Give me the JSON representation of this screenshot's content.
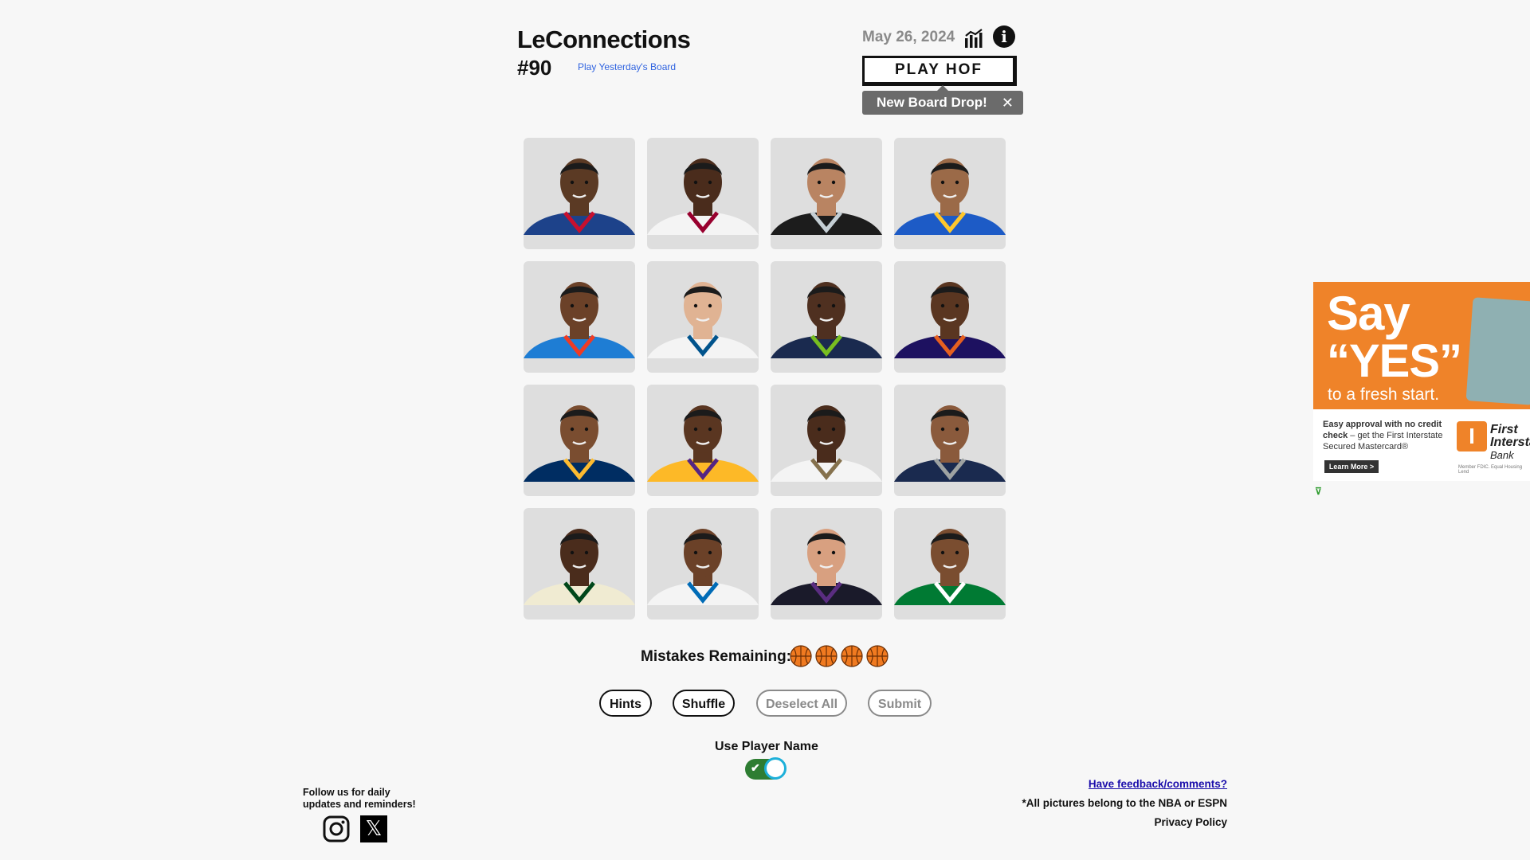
{
  "header": {
    "title": "LeConnections",
    "board_number": "#90",
    "yesterday_link": "Play Yesterday's Board",
    "date": "May 26, 2024",
    "play_hof_label": "PLAY HOF",
    "tooltip_text": "New Board Drop!",
    "tooltip_close": "✕"
  },
  "grid": {
    "tiles": [
      {
        "icon": "player-headshot",
        "jersey": "#1d428a",
        "trim": "#c8102e",
        "skin": "#5b3a24"
      },
      {
        "icon": "player-headshot",
        "jersey": "#f4f4f4",
        "trim": "#98002e",
        "skin": "#4a2c1c"
      },
      {
        "icon": "player-headshot",
        "jersey": "#1c1c1c",
        "trim": "#c4ced4",
        "skin": "#b98462"
      },
      {
        "icon": "player-headshot",
        "jersey": "#1d5bc6",
        "trim": "#ffc72c",
        "skin": "#9b6a48"
      },
      {
        "icon": "player-headshot",
        "jersey": "#1e7dd4",
        "trim": "#ef3b24",
        "skin": "#6b4128"
      },
      {
        "icon": "player-headshot",
        "jersey": "#f4f4f4",
        "trim": "#00538c",
        "skin": "#e0b393"
      },
      {
        "icon": "player-headshot",
        "jersey": "#1a2a4f",
        "trim": "#78be20",
        "skin": "#4f3020"
      },
      {
        "icon": "player-headshot",
        "jersey": "#1d1160",
        "trim": "#e56020",
        "skin": "#5a3621"
      },
      {
        "icon": "player-headshot",
        "jersey": "#002d62",
        "trim": "#fdbb30",
        "skin": "#7a4d30"
      },
      {
        "icon": "player-headshot",
        "jersey": "#fdb927",
        "trim": "#552583",
        "skin": "#5a3621"
      },
      {
        "icon": "player-headshot",
        "jersey": "#f4f4f4",
        "trim": "#85714d",
        "skin": "#4a2c1c"
      },
      {
        "icon": "player-headshot",
        "jersey": "#1a2a4f",
        "trim": "#9ea2a2",
        "skin": "#8a5a3c"
      },
      {
        "icon": "player-headshot",
        "jersey": "#f0ebd2",
        "trim": "#00471b",
        "skin": "#4a2c1c"
      },
      {
        "icon": "player-headshot",
        "jersey": "#f4f4f4",
        "trim": "#006bb6",
        "skin": "#6b4128"
      },
      {
        "icon": "player-headshot",
        "jersey": "#1a1a2a",
        "trim": "#5a2d81",
        "skin": "#d8a080"
      },
      {
        "icon": "player-headshot",
        "jersey": "#007a33",
        "trim": "#ffffff",
        "skin": "#7a4d30"
      }
    ]
  },
  "mistakes": {
    "label": "Mistakes Remaining:",
    "remaining": 4,
    "icon": "basketball-icon",
    "color": "#f07a20"
  },
  "controls": {
    "hints": "Hints",
    "shuffle": "Shuffle",
    "deselect_all": "Deselect All",
    "submit": "Submit"
  },
  "toggle": {
    "label": "Use Player Name",
    "checked": true
  },
  "footer": {
    "follow_line1": "Follow us for daily",
    "follow_line2": "updates and reminders!",
    "instagram_icon": "instagram-icon",
    "x_icon": "x-logo-icon",
    "x_glyph": "𝕏",
    "feedback": "Have feedback/comments?",
    "pictures_note": "*All pictures belong to the NBA or ESPN",
    "privacy": "Privacy Policy"
  },
  "ad": {
    "say": "Say",
    "yes": "“YES”",
    "fresh": "to a fresh start.",
    "body_bold": "Easy approval with no credit check",
    "body_rest": "– get the First Interstate Secured Mastercard®",
    "learn_more": "Learn More >",
    "logo_letter": "I",
    "brand_line1": "First",
    "brand_line2": "Intersta",
    "brand_line3": "Bank",
    "fine_print": "Member FDIC. Equal Housing Lend",
    "marker_icon": "ad-choices-icon",
    "marker_glyph": "⊽"
  }
}
